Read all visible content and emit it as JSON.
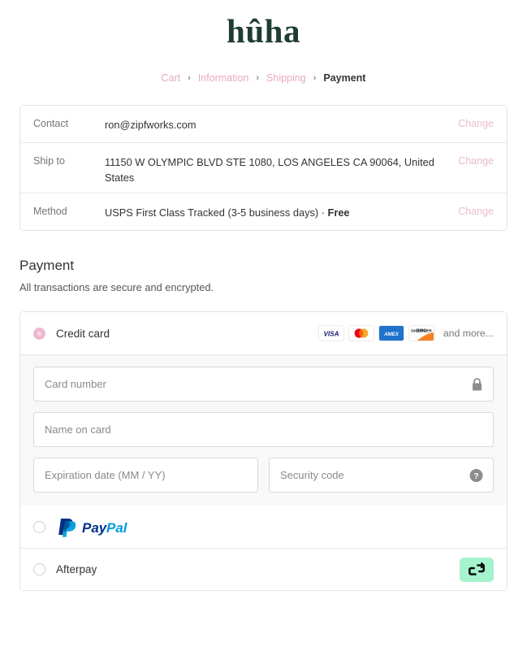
{
  "brand": {
    "logo_text": "hûha",
    "logo_color": "#1f3d31"
  },
  "breadcrumbs": {
    "separator": "›",
    "items": [
      {
        "label": "Cart",
        "current": false
      },
      {
        "label": "Information",
        "current": false
      },
      {
        "label": "Shipping",
        "current": false
      },
      {
        "label": "Payment",
        "current": true
      }
    ],
    "link_color": "#e8aabf",
    "current_color": "#333333"
  },
  "summary": {
    "rows": [
      {
        "label": "Contact",
        "value": "ron@zipfworks.com",
        "value_bold": "",
        "action": "Change"
      },
      {
        "label": "Ship to",
        "value": "11150 W OLYMPIC BLVD STE 1080, LOS ANGELES CA 90064, United States",
        "value_bold": "",
        "action": "Change"
      },
      {
        "label": "Method",
        "value": "USPS First Class Tracked (3-5 business days) · ",
        "value_bold": "Free",
        "action": "Change"
      }
    ],
    "action_color": "#eabccc"
  },
  "payment": {
    "title": "Payment",
    "subtitle": "All transactions are secure and encrypted.",
    "methods": [
      {
        "id": "credit-card",
        "label": "Credit card",
        "selected": true,
        "brands": [
          "visa",
          "mastercard",
          "amex",
          "discover"
        ],
        "brands_more_text": "and more..."
      },
      {
        "id": "paypal",
        "label": "PayPal",
        "selected": false,
        "wordmark_pay": "Pay",
        "wordmark_pal": "Pal"
      },
      {
        "id": "afterpay",
        "label": "Afterpay",
        "selected": false,
        "badge_color": "#a5f3cd"
      }
    ],
    "card_form": {
      "card_number": {
        "placeholder": "Card number",
        "value": "",
        "icon": "lock-icon"
      },
      "name_on_card": {
        "placeholder": "Name on card",
        "value": ""
      },
      "expiration": {
        "placeholder": "Expiration date (MM / YY)",
        "value": ""
      },
      "security_code": {
        "placeholder": "Security code",
        "value": "",
        "icon": "help-icon"
      }
    }
  }
}
